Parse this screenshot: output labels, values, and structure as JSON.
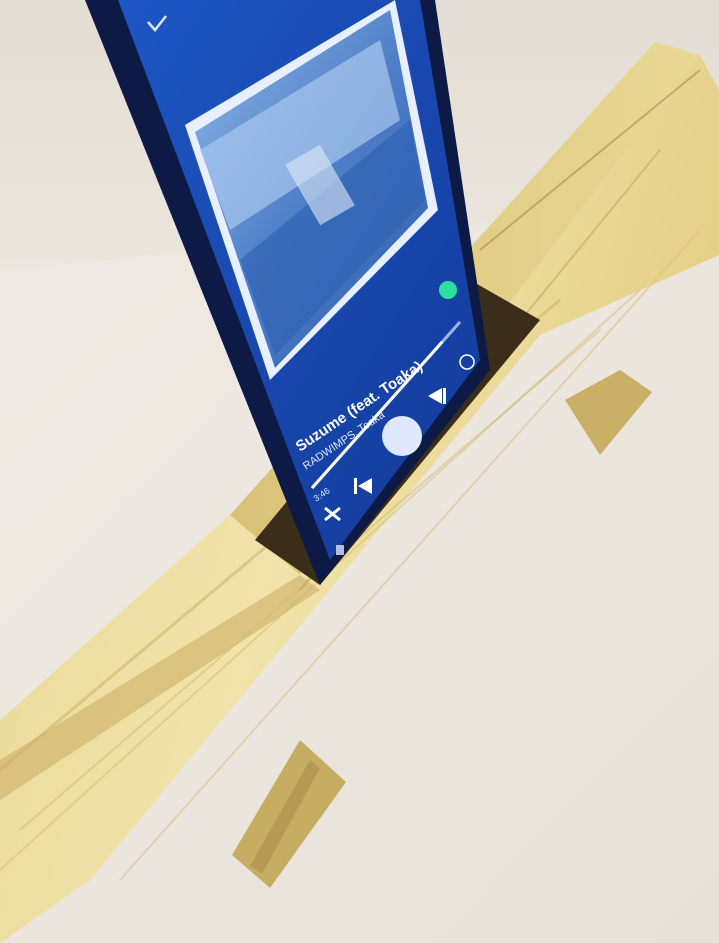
{
  "photo": {
    "colors": {
      "wall": "#ece7df",
      "table": "#eee8e0",
      "wood_light": "#efe1a4",
      "wood_mid": "#dcc47a",
      "wood_dark": "#b79e55",
      "phone_body": "#0c1a45",
      "screen_blue": "#1d4fb8",
      "accent_green": "#2ee0a0"
    }
  },
  "player": {
    "song_title": "Suzume (feat. Toaka)",
    "artist": "RADWIMPS, Toaka",
    "elapsed": "3:46",
    "progress_fraction": 0.88,
    "icons": [
      "chevron-down-icon",
      "shuffle-icon",
      "previous-icon",
      "play-pause-icon",
      "next-icon",
      "add-icon",
      "device-icon"
    ]
  }
}
